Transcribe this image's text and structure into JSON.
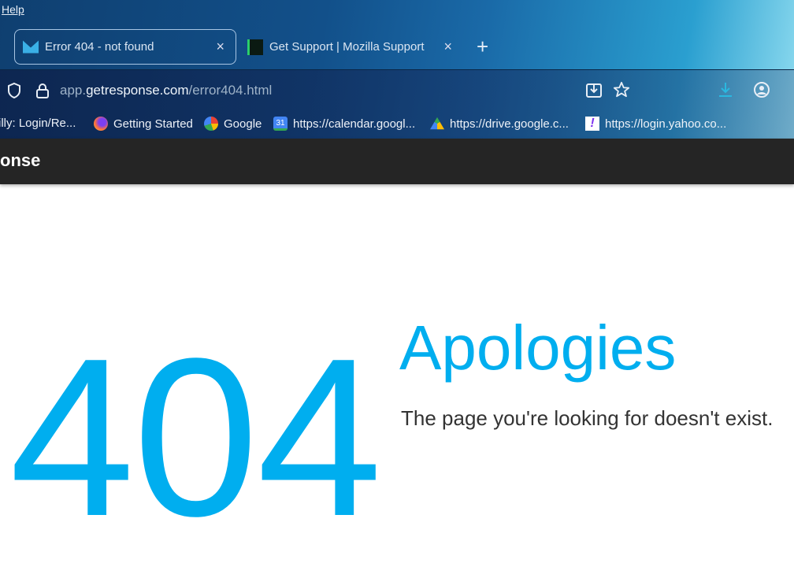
{
  "menu": {
    "help": "Help"
  },
  "tabs": [
    {
      "label": "Error 404 - not found",
      "close": "×"
    },
    {
      "label": "Get Support | Mozilla Support",
      "close": "×"
    }
  ],
  "new_tab": "+",
  "url": {
    "prefix": "app.",
    "domain": "getresponse.com",
    "path": "/error404.html"
  },
  "bookmarks": [
    {
      "label": "illy: Login/Re..."
    },
    {
      "label": "Getting Started"
    },
    {
      "label": "Google"
    },
    {
      "label": "https://calendar.googl...",
      "badge": "31"
    },
    {
      "label": "https://drive.google.c..."
    },
    {
      "label": "https://login.yahoo.co...",
      "badge": "!"
    }
  ],
  "header": {
    "logo": "onse"
  },
  "error": {
    "code": "404",
    "title": "Apologies",
    "message": "The page you're looking for doesn't exist."
  },
  "colors": {
    "accent": "#00aeef",
    "header": "#252525"
  }
}
